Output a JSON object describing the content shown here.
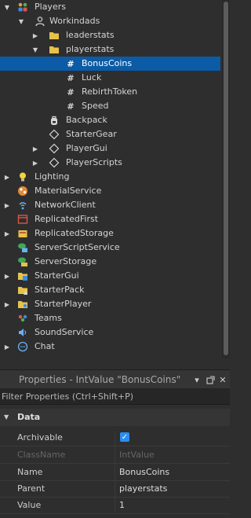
{
  "explorer": {
    "players": "Players",
    "user": "Workindads",
    "leaderstats": "leaderstats",
    "playerstats": "playerstats",
    "bonus_coins": "BonusCoins",
    "luck": "Luck",
    "rebirth_token": "RebirthToken",
    "speed": "Speed",
    "backpack": "Backpack",
    "starter_gear": "StarterGear",
    "player_gui": "PlayerGui",
    "player_scripts": "PlayerScripts",
    "lighting": "Lighting",
    "material_service": "MaterialService",
    "network_client": "NetworkClient",
    "replicated_first": "ReplicatedFirst",
    "replicated_storage": "ReplicatedStorage",
    "server_script_service": "ServerScriptService",
    "server_storage": "ServerStorage",
    "starter_gui": "StarterGui",
    "starter_pack": "StarterPack",
    "starter_player": "StarterPlayer",
    "teams": "Teams",
    "sound_service": "SoundService",
    "chat": "Chat",
    "hash_glyph": "#"
  },
  "properties": {
    "title": "Properties - IntValue \"BonusCoins\"",
    "filter_placeholder": "Filter Properties (Ctrl+Shift+P)",
    "section": "Data",
    "rows": {
      "archivable": {
        "name": "Archivable",
        "value": true
      },
      "classname": {
        "name": "ClassName",
        "value": "IntValue"
      },
      "name": {
        "name": "Name",
        "value": "BonusCoins"
      },
      "parent": {
        "name": "Parent",
        "value": "playerstats"
      },
      "value": {
        "name": "Value",
        "value": "1"
      }
    }
  },
  "colors": {
    "selection": "#0b5ba6",
    "background": "#2e2e2e",
    "folder": "#e8c24a",
    "checkbox": "#2a8ef0"
  }
}
